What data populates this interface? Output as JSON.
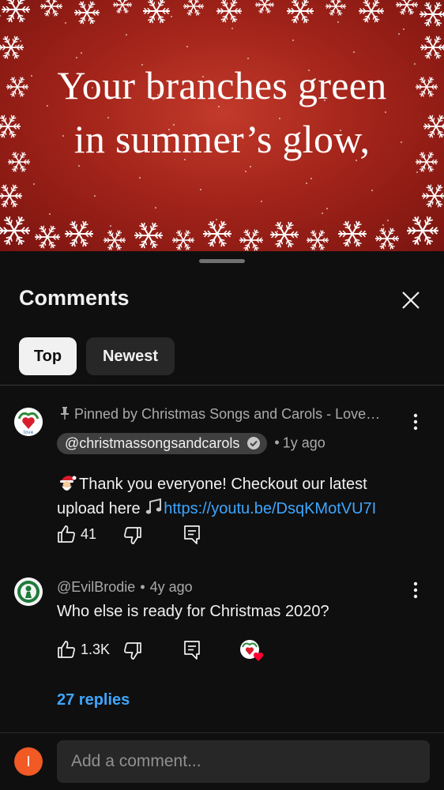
{
  "video": {
    "lyric_line_1": "Your branches green",
    "lyric_line_2": "in summer’s glow,"
  },
  "comments_sheet": {
    "title": "Comments",
    "close_icon": "close-icon",
    "filters": [
      {
        "label": "Top",
        "selected": true
      },
      {
        "label": "Newest",
        "selected": false
      }
    ],
    "comments": [
      {
        "pinned_label": "Pinned by Christmas Songs and Carols - Love…",
        "author": "@christmassongsandcarols",
        "verified": true,
        "time": "1y ago",
        "text_line_1": "Thank you everyone! Checkout our latest",
        "text_line_2_prefix": "upload here ",
        "link": "https://youtu.be/DsqKMotVU7I",
        "emoji_leading": "santa-emoji",
        "emoji_music": "musical-note-emoji",
        "likes": "41"
      },
      {
        "author": "@EvilBrodie",
        "time": "4y ago",
        "text": "Who else is ready for Christmas 2020?",
        "likes": "1.3K",
        "creator_heart": true,
        "replies": "27 replies"
      }
    ],
    "add_comment": {
      "avatar_letter": "I",
      "placeholder": "Add a comment..."
    }
  },
  "colors": {
    "background": "#0f0f0f",
    "link": "#3ea6ff",
    "avatar_orange": "#f15a24",
    "video_red": "#a3241a"
  }
}
